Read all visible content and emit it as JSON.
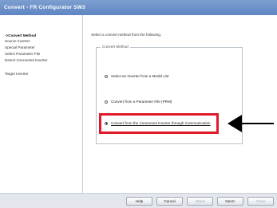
{
  "window": {
    "title": "Convert - FR Configurator SW3"
  },
  "nav": {
    "items": [
      {
        "label": "->Convert Method",
        "active": true
      },
      {
        "label": "Source Inverter",
        "active": false
      },
      {
        "label": "Special Parameter",
        "active": false
      },
      {
        "label": "Select Parameter File",
        "active": false
      },
      {
        "label": "Detect Connected Inverter",
        "active": false
      },
      {
        "label": "Target Inverter",
        "active": false
      }
    ]
  },
  "content": {
    "instruction": "Select a convert method from the following.",
    "group_label": "Convert Method",
    "options": [
      {
        "label": "Select an Inverter from a Model List",
        "selected": false
      },
      {
        "label": "Convert from a Parameter File (PRM)",
        "selected": false
      },
      {
        "label": "Convert from the Connected Inverter through Communication",
        "selected": true
      }
    ]
  },
  "buttons": {
    "help": "Help",
    "cancel": "Cancel",
    "back": "<Back",
    "next": "Next>",
    "close": "Close"
  },
  "colors": {
    "highlight": "#e01a2a",
    "titlebar": "#6a8fc9"
  }
}
